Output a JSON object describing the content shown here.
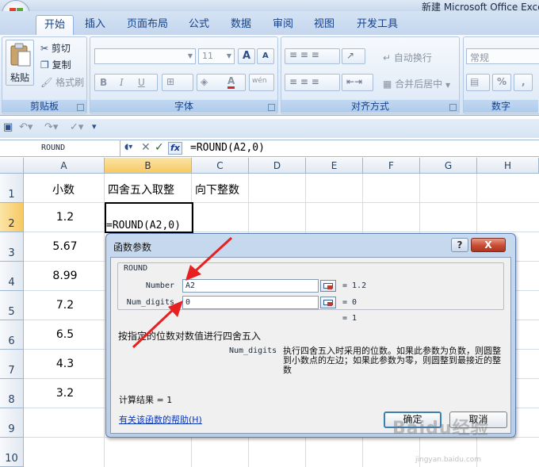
{
  "window": {
    "title": "新建 Microsoft Office Exce"
  },
  "tabs": [
    "开始",
    "插入",
    "页面布局",
    "公式",
    "数据",
    "审阅",
    "视图",
    "开发工具"
  ],
  "ribbon": {
    "clipboard": {
      "paste": "粘贴",
      "cut": "剪切",
      "copy": "复制",
      "format_painter": "格式刷",
      "label": "剪贴板"
    },
    "font": {
      "font_size": "11",
      "bold": "B",
      "italic": "I",
      "underline": "U",
      "grow": "A",
      "shrink": "A",
      "color_a": "A",
      "phonetic": "wén",
      "label": "字体"
    },
    "alignment": {
      "wrap_text": "自动换行",
      "merge_center": "合并后居中",
      "label": "对齐方式"
    },
    "number": {
      "format": "常规",
      "percent": "%",
      "comma": ",",
      "label": "数字"
    }
  },
  "formula_bar": {
    "name_box": "ROUND",
    "fx": "fx",
    "formula": "=ROUND(A2,0)"
  },
  "grid": {
    "columns": [
      "A",
      "B",
      "C",
      "D",
      "E",
      "F",
      "G",
      "H"
    ],
    "rows": [
      "1",
      "2",
      "3",
      "4",
      "5",
      "6",
      "7",
      "8",
      "9",
      "10"
    ],
    "header_row": {
      "a": "小数",
      "b": "四舍五入取整",
      "c": "向下整数"
    },
    "values": [
      "1.2",
      "5.67",
      "8.99",
      "7.2",
      "6.5",
      "4.3",
      "3.2"
    ],
    "b2": "=ROUND(A2,0)"
  },
  "dialog": {
    "title": "函数参数",
    "help_button": "?",
    "close_button": "X",
    "function_name": "ROUND",
    "args": [
      {
        "label": "Number",
        "value": "A2",
        "result": "= 1.2"
      },
      {
        "label": "Num_digits",
        "value": "0",
        "result": "= 0"
      }
    ],
    "overall_result": "= 1",
    "description": "按指定的位数对数值进行四舍五入",
    "param_name": "Num_digits",
    "param_description": "执行四舍五入时采用的位数。如果此参数为负数，则圆整到小数点的左边；如果此参数为零，则圆整到最接近的整数",
    "calc_result": "计算结果 = 1",
    "help_link": "有关该函数的帮助(H)",
    "ok": "确定",
    "cancel": "取消"
  },
  "watermark": {
    "brand": "Baidu经验",
    "url": "jingyan.baidu.com"
  },
  "colors": {
    "ribbon_text": "#15428b",
    "selection_header": "#f7c963",
    "arrow_red": "#e8201f",
    "close_red": "#c74b33"
  }
}
